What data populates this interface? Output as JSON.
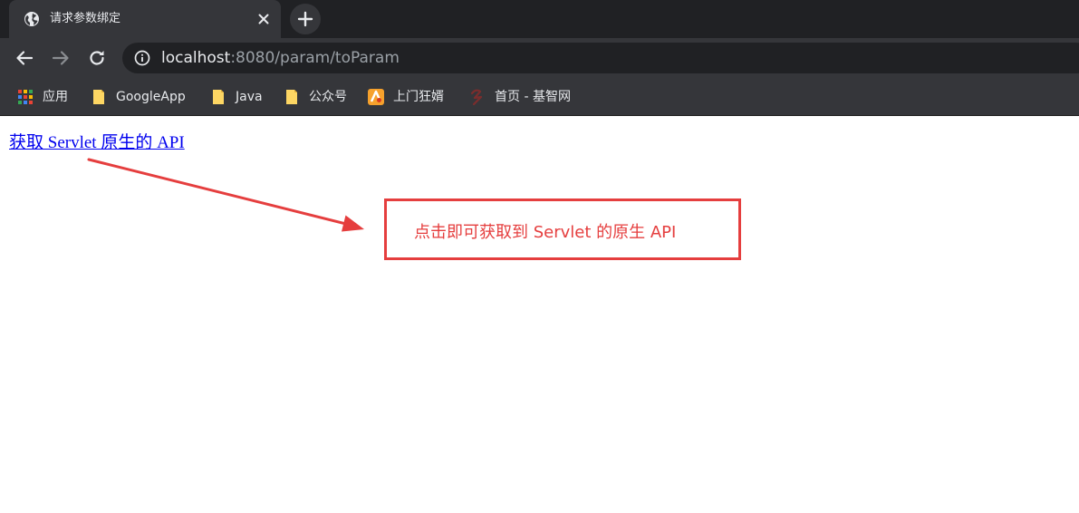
{
  "tab": {
    "title": "请求参数绑定",
    "icon": "globe-icon"
  },
  "address_bar": {
    "host": "localhost",
    "rest": ":8080/param/toParam"
  },
  "bookmarks": [
    {
      "label": "应用",
      "icon": "apps-grid-icon"
    },
    {
      "label": "GoogleApp",
      "icon": "folder-icon"
    },
    {
      "label": "Java",
      "icon": "folder-icon"
    },
    {
      "label": "公众号",
      "icon": "folder-icon"
    },
    {
      "label": "上门狂婿",
      "icon": "site-favicon-icon"
    },
    {
      "label": "首页 - 基智网",
      "icon": "site-favicon-icon"
    }
  ],
  "page": {
    "link_text": "获取 Servlet 原生的 API",
    "callout_text": "点击即可获取到 Servlet 的原生 API"
  },
  "colors": {
    "annotation_red": "#e53e3e",
    "link_blue": "#0000ee",
    "chrome_dark": "#202124",
    "chrome_toolbar": "#35363a"
  }
}
